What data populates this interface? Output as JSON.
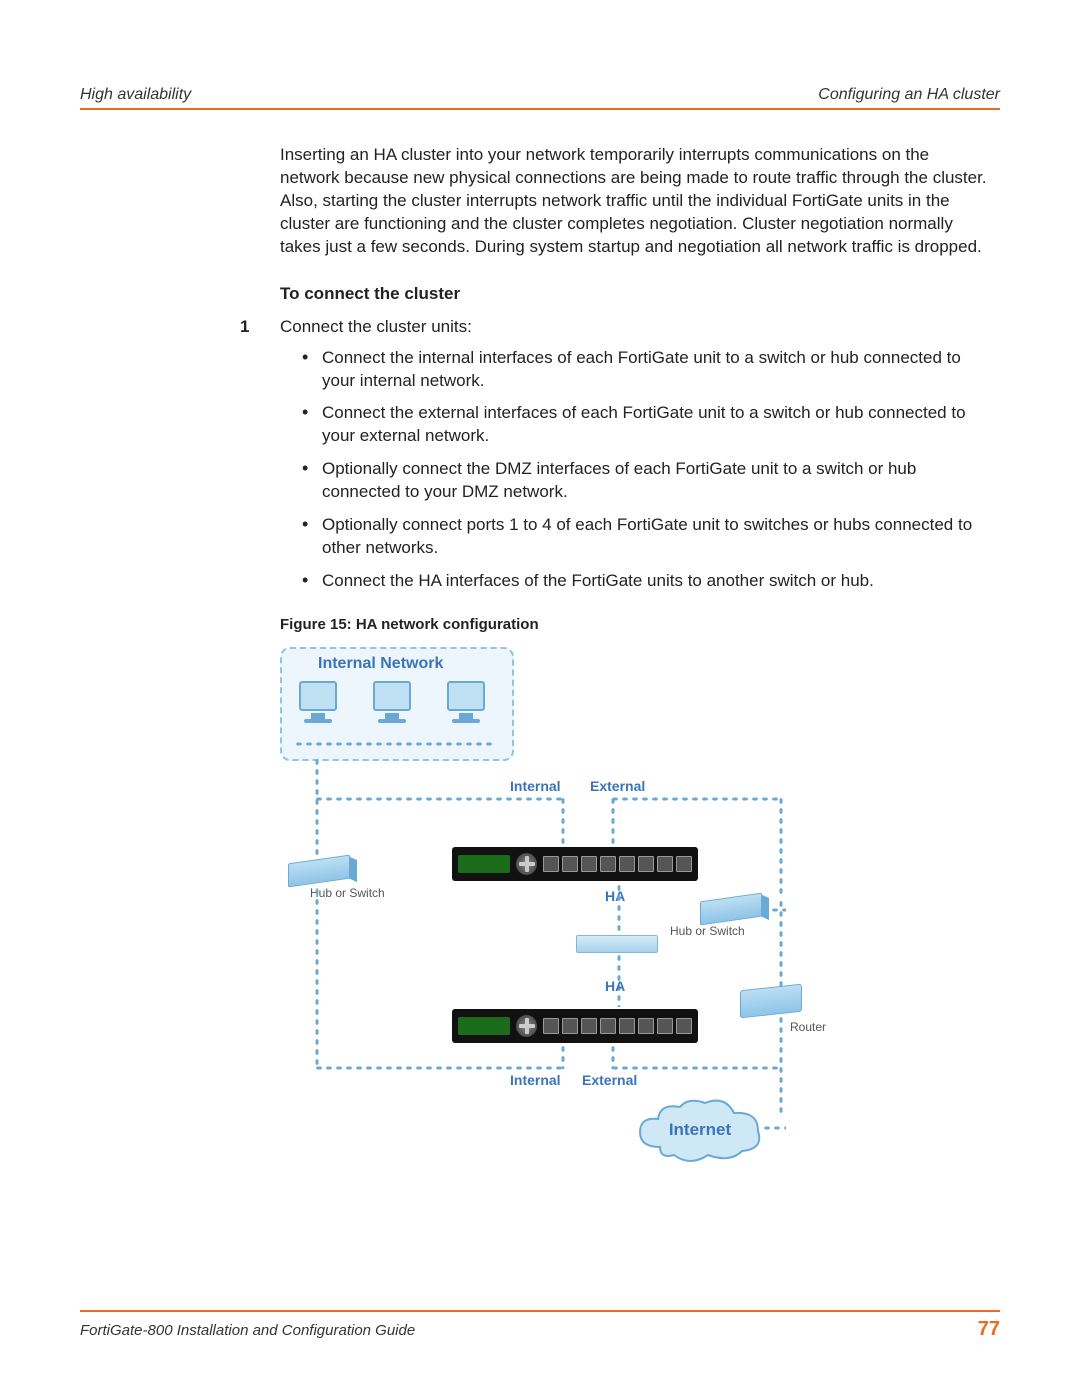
{
  "header": {
    "left": "High availability",
    "right": "Configuring an HA cluster"
  },
  "intro": "Inserting an HA cluster into your network temporarily interrupts communications on the network because new physical connections are being made to route traffic through the cluster. Also, starting the cluster interrupts network traffic until the individual FortiGate units in the cluster are functioning and the cluster completes negotiation. Cluster negotiation normally takes just a few seconds. During system startup and negotiation all network traffic is dropped.",
  "subhead": "To connect the cluster",
  "step_number": "1",
  "step_text": "Connect the cluster units:",
  "bullets": [
    "Connect the internal interfaces of each FortiGate unit to a switch or hub connected to your internal network.",
    "Connect the external interfaces of each FortiGate unit to a switch or hub connected to your external network.",
    "Optionally connect the DMZ interfaces of each FortiGate unit to a switch or hub connected to your DMZ network.",
    "Optionally connect ports 1 to 4 of each FortiGate unit to switches or hubs connected to other networks.",
    "Connect the HA interfaces of the FortiGate units to another switch or hub."
  ],
  "figure_caption": "Figure 15: HA network configuration",
  "diagram": {
    "internal_network": "Internal Network",
    "internal": "Internal",
    "external": "External",
    "ha": "HA",
    "hub_or_switch": "Hub or Switch",
    "router": "Router",
    "internet": "Internet"
  },
  "footer": {
    "left": "FortiGate-800 Installation and Configuration Guide",
    "page": "77"
  }
}
